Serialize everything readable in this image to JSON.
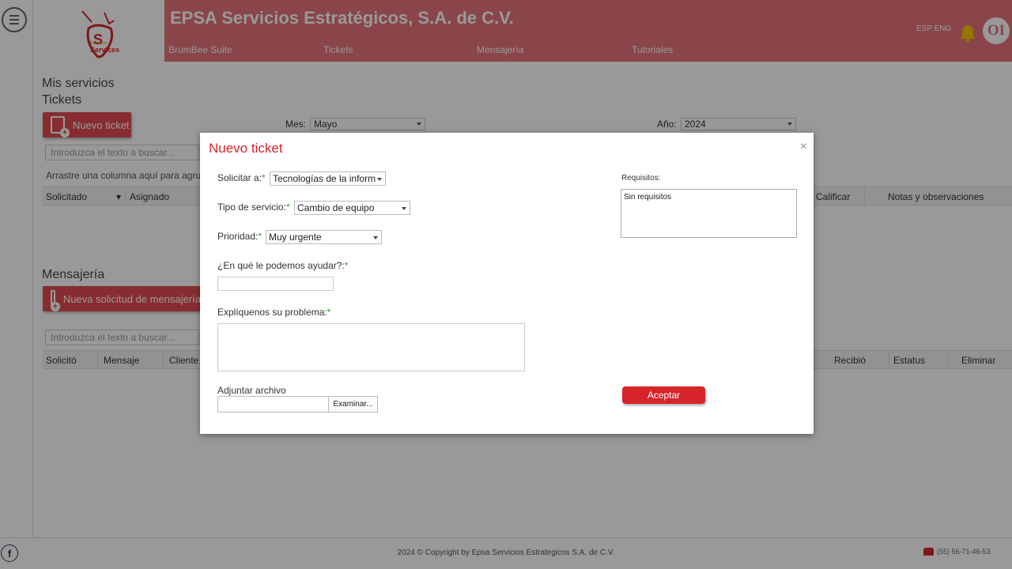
{
  "header": {
    "company": "EPSA Servicios Estratégicos, S.A. de C.V.",
    "nav": [
      "BrumBee Suite",
      "Tickets",
      "Mensajería",
      "Tutoriales"
    ],
    "lang": "ESP ENG",
    "avatar_initials": "OI",
    "logo_text": "Services",
    "logo_small": "BrumBee"
  },
  "services": {
    "title": "Mis servicios",
    "tickets_title": "Tickets",
    "new_ticket_button": "Nuevo ticket",
    "search_placeholder": "Introduzca el texto a buscar...",
    "month_label": "Mes:",
    "month_value": "Mayo",
    "year_label": "Año:",
    "year_value": "2024",
    "group_hint": "Arrastre una columna aquí para agrupar",
    "columns": [
      "Solicitado",
      "Asignado",
      "Calificar",
      "Notas y observaciones"
    ]
  },
  "messaging": {
    "title": "Mensajería",
    "new_request_button": "Nueva solicitud de mensajería",
    "search_placeholder": "Introduzca el texto a buscar...",
    "columns": [
      "Solicitó",
      "Mensaje",
      "Cliente",
      "Recibió",
      "Estatus",
      "Eliminar"
    ]
  },
  "modal": {
    "title": "Nuevo ticket",
    "close": "×",
    "solicitar_label": "Solicitar a:",
    "solicitar_value": "Tecnologías de la inform",
    "tipo_label": "Tipo de servicio:",
    "tipo_value": "Cambio de equipo",
    "prioridad_label": "Prioridad:",
    "prioridad_value": "Muy urgente",
    "ayuda_label": "¿En qué le podemos ayudar?:",
    "problema_label": "Explíquenos su problema:",
    "adjuntar_label": "Adjuntar archivo",
    "examinar_button": "Examinar...",
    "requisitos_label": "Requisitos:",
    "requisitos_value": "Sin requisitos",
    "accept_button": "Aceptar",
    "required_mark": "*"
  },
  "footer": {
    "copyright": "2024 © Copyright by Epsa Servicios Estrategicos S.A. de C.V.",
    "phone": "(55) 56-71-46-53",
    "facebook_glyph": "f"
  },
  "colors": {
    "header_bg": "#e4737a",
    "accent_red": "#d8232a",
    "required_green": "#2e9d2e"
  }
}
